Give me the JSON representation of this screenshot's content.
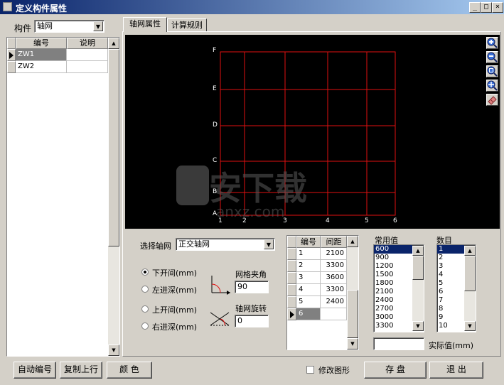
{
  "window": {
    "title": "定义构件属性",
    "controls": [
      "_",
      "□",
      "×"
    ]
  },
  "left": {
    "component_label": "构件",
    "component_value": "轴网",
    "grid_headers": [
      "编号",
      "说明"
    ],
    "rows": [
      {
        "id": "ZW1",
        "desc": ""
      },
      {
        "id": "ZW2",
        "desc": ""
      }
    ]
  },
  "tabs": [
    {
      "label": "轴网属性",
      "active": true
    },
    {
      "label": "计算规则",
      "active": false
    }
  ],
  "canvas": {
    "y_labels": [
      "F",
      "E",
      "D",
      "C",
      "B",
      "A"
    ],
    "x_labels": [
      "1",
      "2",
      "3",
      "4",
      "5",
      "6"
    ]
  },
  "settings": {
    "select_label": "选择轴网",
    "select_value": "正交轴网",
    "radios": [
      {
        "label": "下开间(mm)",
        "checked": true
      },
      {
        "label": "左进深(mm)",
        "checked": false
      },
      {
        "label": "上开间(mm)",
        "checked": false
      },
      {
        "label": "右进深(mm)",
        "checked": false
      }
    ],
    "angle_label": "网格夹角",
    "angle_value": "90",
    "rotate_label": "轴网旋转",
    "rotate_value": "0"
  },
  "spacing_table": {
    "headers": [
      "编号",
      "间距"
    ],
    "rows": [
      {
        "no": "1",
        "gap": "2100"
      },
      {
        "no": "2",
        "gap": "3300"
      },
      {
        "no": "3",
        "gap": "3600"
      },
      {
        "no": "4",
        "gap": "3300"
      },
      {
        "no": "5",
        "gap": "2400"
      },
      {
        "no": "6",
        "gap": ""
      }
    ]
  },
  "common_values": {
    "label": "常用值",
    "items": [
      "600",
      "900",
      "1200",
      "1500",
      "1800",
      "2100",
      "2400",
      "2700",
      "3000",
      "3300"
    ]
  },
  "counts": {
    "label": "数目",
    "items": [
      "1",
      "2",
      "3",
      "4",
      "5",
      "6",
      "7",
      "8",
      "9",
      "10"
    ]
  },
  "actual_value_label": "实际值(mm)",
  "bottom": {
    "auto_number": "自动编号",
    "copy_row": "复制上行",
    "color": "颜 色",
    "modify_shape": "修改图形",
    "save": "存 盘",
    "exit": "退 出"
  },
  "colors": {
    "title_bar": "#0a246a",
    "grid_line": "#e01010",
    "canvas_bg": "#000000",
    "selection": "#0a246a"
  }
}
